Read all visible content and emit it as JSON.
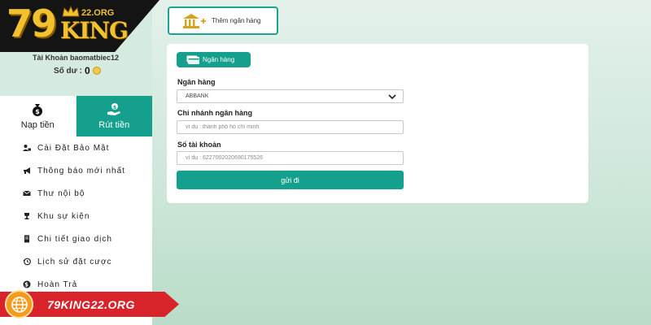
{
  "logo": {
    "main": "79",
    "brand": "KING",
    "domain": "22.ORG"
  },
  "account": {
    "label": "Tài Khoản baomatbiec12",
    "balance_label": "Số dư :",
    "balance_value": "0"
  },
  "tabs": [
    {
      "label": "Nạp tiền",
      "icon": "money-bag-icon",
      "active": false
    },
    {
      "label": "Rút tiền",
      "icon": "hand-coin-icon",
      "active": true
    }
  ],
  "menu": [
    {
      "label": "Cài Đặt Bảo Mật",
      "icon": "user-lock-icon"
    },
    {
      "label": "Thông báo mới nhất",
      "icon": "megaphone-icon"
    },
    {
      "label": "Thư nội bộ",
      "icon": "envelope-icon"
    },
    {
      "label": "Khu sự kiện",
      "icon": "trophy-icon"
    },
    {
      "label": "Chi tiết giao dịch",
      "icon": "document-icon"
    },
    {
      "label": "Lịch sử đặt cược",
      "icon": "history-icon"
    },
    {
      "label": "Hoàn Trả",
      "icon": "dollar-circle-icon"
    }
  ],
  "add_bank": {
    "label": "Thêm ngân hàng",
    "icon": "bank-add-icon"
  },
  "form": {
    "tag": "Ngân hàng",
    "bank_label": "Ngân hàng",
    "bank_value": "ABBANK",
    "branch_label": "Chi nhánh ngân hàng",
    "branch_placeholder": "ví dụ : thành phố hồ chí minh",
    "account_label": "Số tài khoản",
    "account_placeholder": "ví dụ : 6227002020690175526",
    "submit": "gửi đi"
  },
  "banner": {
    "text": "79KING22.ORG",
    "icon": "globe-icon"
  },
  "colors": {
    "accent": "#14a08c",
    "banner": "#d8232a",
    "gold": "#f2c12e"
  }
}
